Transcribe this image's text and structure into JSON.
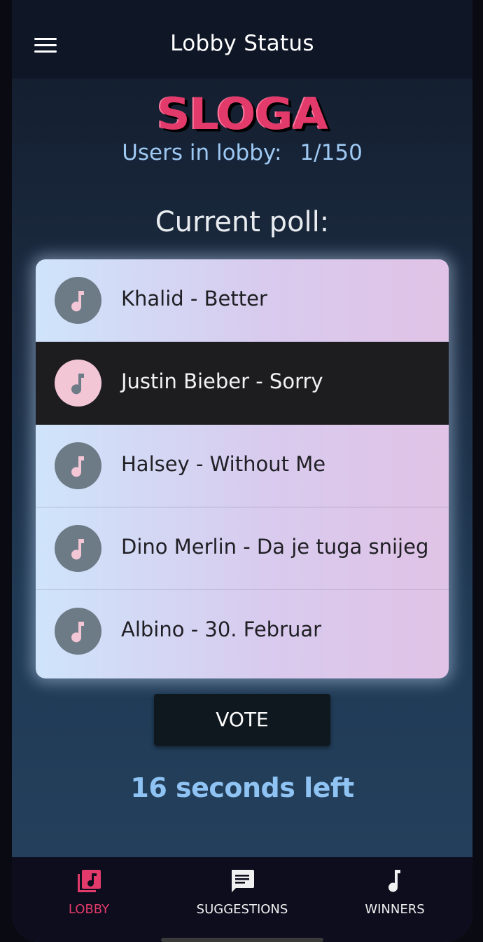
{
  "app": {
    "title": "Lobby Status",
    "logo_text": "SLOGA"
  },
  "lobby": {
    "users_label": "Users in lobby:",
    "users_count": "1/150"
  },
  "poll": {
    "heading": "Current poll:",
    "items": [
      {
        "label": "Khalid - Better",
        "selected": false
      },
      {
        "label": "Justin Bieber - Sorry",
        "selected": true
      },
      {
        "label": "Halsey - Without Me",
        "selected": false
      },
      {
        "label": "Dino Merlin - Da je tuga snijeg",
        "selected": false
      },
      {
        "label": "Albino - 30. Februar",
        "selected": false
      }
    ],
    "vote_label": "VOTE",
    "countdown": "16 seconds left"
  },
  "nav": {
    "items": [
      {
        "label": "LOBBY",
        "icon": "library-music-icon",
        "active": true
      },
      {
        "label": "SUGGESTIONS",
        "icon": "chat-message-icon",
        "active": false
      },
      {
        "label": "WINNERS",
        "icon": "music-note-icon",
        "active": false
      }
    ]
  },
  "colors": {
    "accent": "#e23a6a",
    "countdown": "#8fc3f3",
    "users_text": "#9ec9f3"
  }
}
